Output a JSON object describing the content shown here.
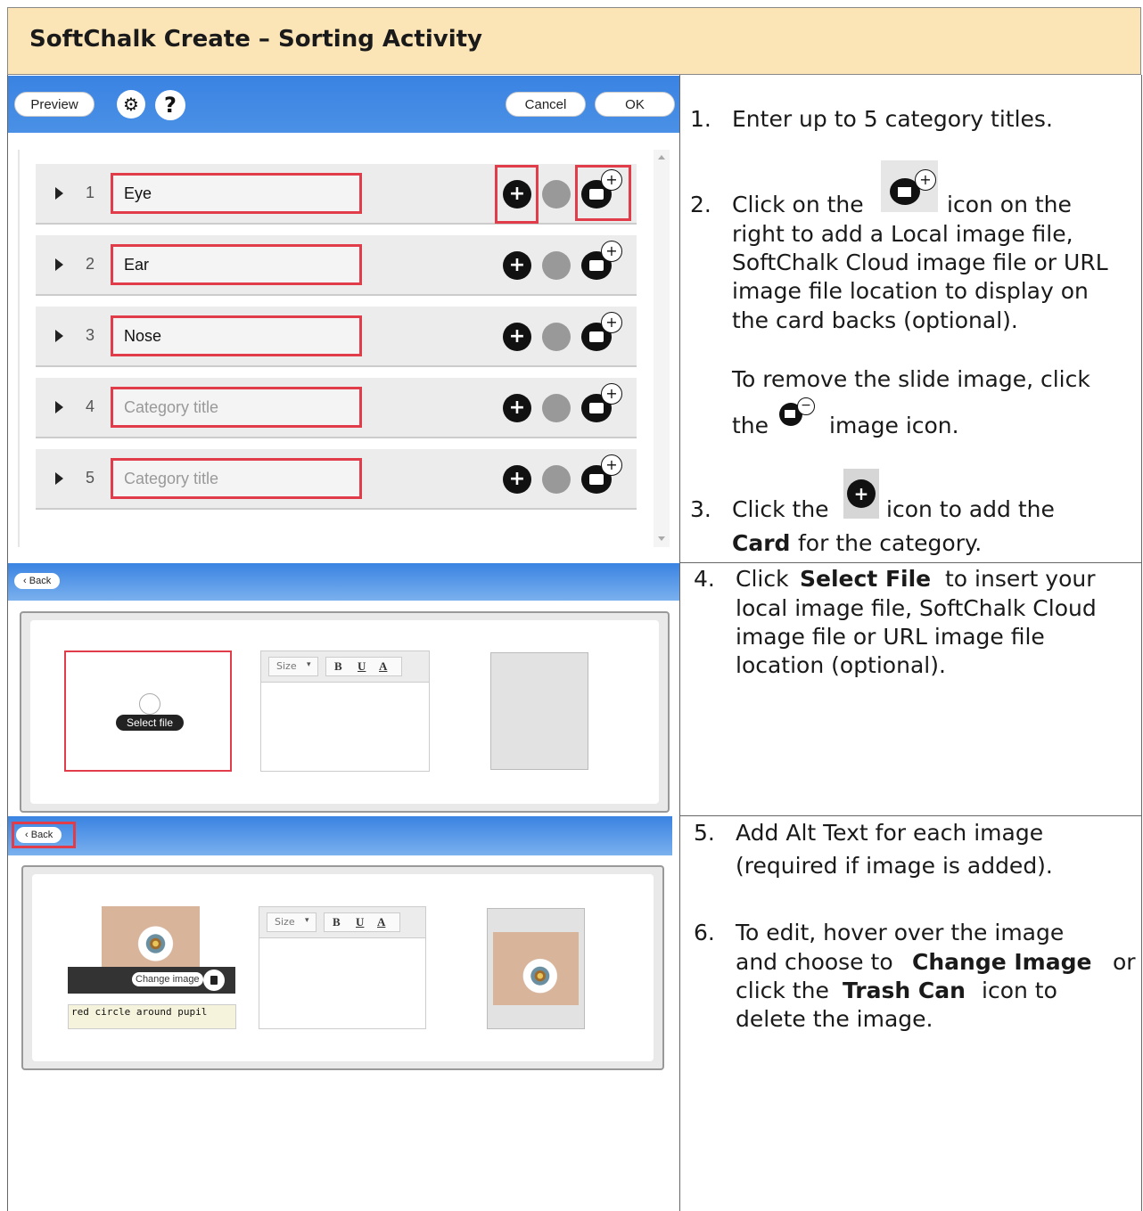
{
  "title": "SoftChalk Create – Sorting Activity",
  "toolbar": {
    "preview": "Preview",
    "cancel": "Cancel",
    "ok": "OK",
    "settings_icon": "gear-icon",
    "help": "?"
  },
  "categories": [
    {
      "n": "1",
      "value": "Eye",
      "placeholder": false
    },
    {
      "n": "2",
      "value": "Ear",
      "placeholder": false
    },
    {
      "n": "3",
      "value": "Nose",
      "placeholder": false
    },
    {
      "n": "4",
      "value": "Category title",
      "placeholder": true
    },
    {
      "n": "5",
      "value": "Category title",
      "placeholder": true
    }
  ],
  "back": "Back",
  "select_file": "Select file",
  "editor": {
    "size": "Size",
    "b": "B",
    "u": "U",
    "a": "A"
  },
  "change_image": "Change image",
  "alt_text": "red circle around pupil",
  "instructions": {
    "i1": "Enter up to 5 category titles.",
    "i2a": "Click on the",
    "i2b": "icon on the",
    "i2c": "right to add a Local image file,",
    "i2d": "SoftChalk Cloud image file or URL",
    "i2e": "image file location to display on",
    "i2f": "the card backs (optional).",
    "i2g": "To remove the slide image, click",
    "i2h": "the",
    "i2i": "image icon.",
    "i3a": "Click the",
    "i3b": "icon to add the",
    "i3c": "Card",
    "i3d": "for the category.",
    "i4a": "Click",
    "i4b": "Select File",
    "i4c": "to insert your",
    "i4d": "local image file, SoftChalk Cloud",
    "i4e": "image file or URL image file",
    "i4f": "location (optional).",
    "i5a": "Add Alt Text for each image",
    "i5b": "(required if image is added).",
    "i6a": "To edit, hover over the image",
    "i6b": "and choose to",
    "i6c": "Change Image",
    "i6d": "or",
    "i6e": "click the",
    "i6f": "Trash Can",
    "i6g": "icon to",
    "i6h": "delete the image.",
    "nums": [
      "1.",
      "2.",
      "3.",
      "4.",
      "5.",
      "6."
    ]
  }
}
